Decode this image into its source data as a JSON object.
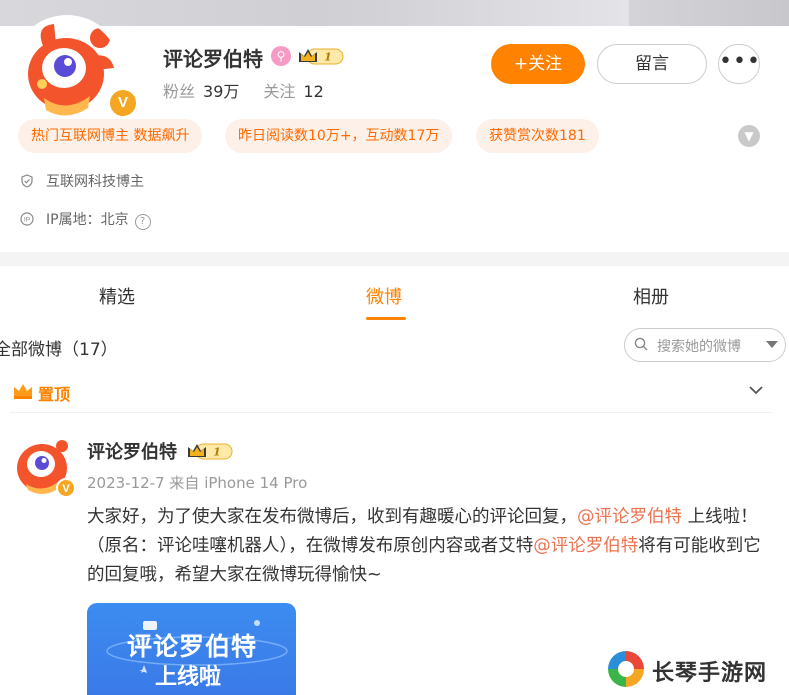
{
  "profile": {
    "name": "评论罗伯特",
    "badge_v": "V",
    "level": "1",
    "fans_label": "粉丝",
    "fans_value": "39万",
    "following_label": "关注",
    "following_value": "12",
    "follow_button": "+关注",
    "message_button": "留言",
    "more_button": "•••"
  },
  "tags": [
    "热门互联网博主 数据飙升",
    "昨日阅读数10万+，互动数17万",
    "获赞赏次数181"
  ],
  "info": {
    "category": "互联网科技博主",
    "ip_label": "IP属地：北京",
    "help": "?"
  },
  "tabs": [
    "精选",
    "微博",
    "相册"
  ],
  "active_tab": "微博",
  "filter": {
    "label": "全部微博（17）",
    "search_placeholder": "搜索她的微博"
  },
  "pinned": {
    "label": "置顶"
  },
  "post": {
    "author": "评论罗伯特",
    "level": "1",
    "date": "2023-12-7",
    "source": "来自 iPhone 14 Pro",
    "text_1": "大家好，为了使大家在发布微博后，收到有趣暖心的评论回复，",
    "mention_1": "@评论罗伯特",
    "text_2": " 上线啦！（原名：评论哇噻机器人），在微博发布原创内容或者艾特",
    "mention_2": "@评论罗伯特",
    "text_3": "将有可能收到它的回复哦，希望大家在微博玩得愉快~",
    "card_line1": "评论罗伯特",
    "card_line2": "上线啦"
  },
  "watermark": {
    "text": "长琴手游网"
  },
  "colors": {
    "accent": "#ff8200",
    "tag_bg": "#fdf0e8",
    "tag_text": "#ff6a00",
    "mention": "#eb7350"
  }
}
